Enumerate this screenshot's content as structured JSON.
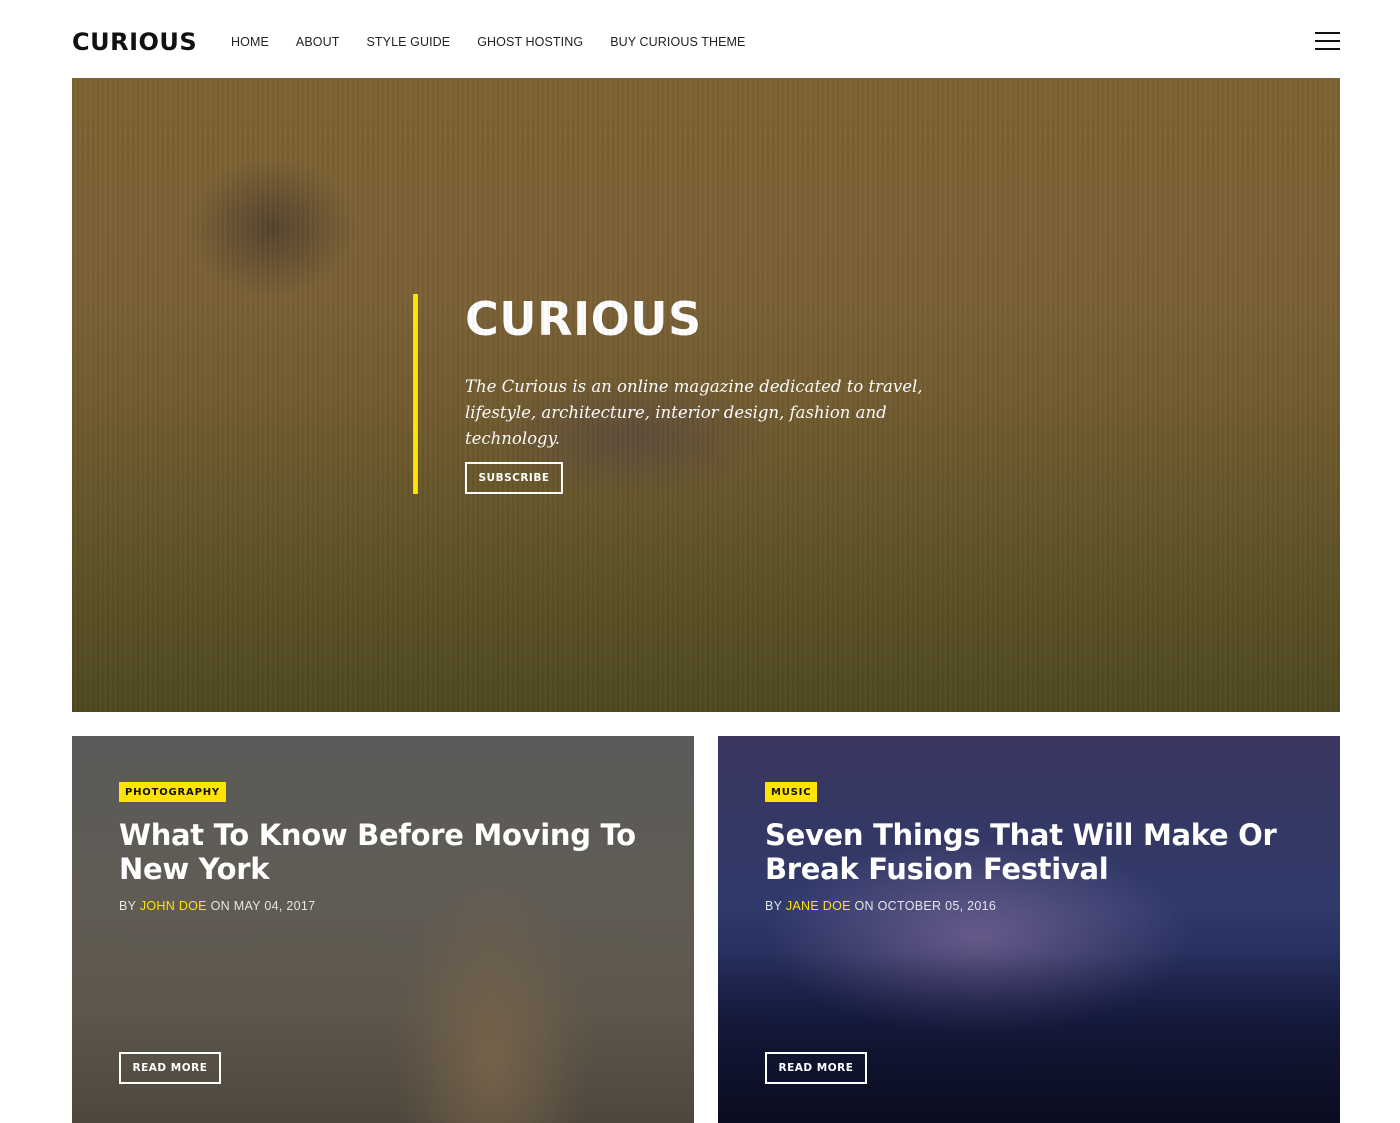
{
  "header": {
    "logo": "CURIOUS",
    "nav": [
      "HOME",
      "ABOUT",
      "STYLE GUIDE",
      "GHOST HOSTING",
      "BUY CURIOUS THEME"
    ]
  },
  "hero": {
    "title": "CURIOUS",
    "description": "The Curious is an online magazine dedicated to travel, lifestyle, architecture, interior design, fashion and technology.",
    "button_label": "SUBSCRIBE"
  },
  "posts": [
    {
      "tag": "PHOTOGRAPHY",
      "title": "What To Know Before Moving To New York",
      "by": "BY ",
      "author": "JOHN DOE",
      "on": " ON ",
      "date": "MAY 04, 2017",
      "button_label": "READ MORE"
    },
    {
      "tag": "MUSIC",
      "title": "Seven Things That Will Make Or Break Fusion Festival",
      "by": "BY ",
      "author": "JANE DOE",
      "on": " ON ",
      "date": "OCTOBER 05, 2016",
      "button_label": "READ MORE"
    }
  ],
  "colors": {
    "accent": "#ffe400",
    "text_dark": "#111111",
    "background": "#ffffff"
  },
  "icons": {
    "menu": "hamburger-menu-icon"
  }
}
